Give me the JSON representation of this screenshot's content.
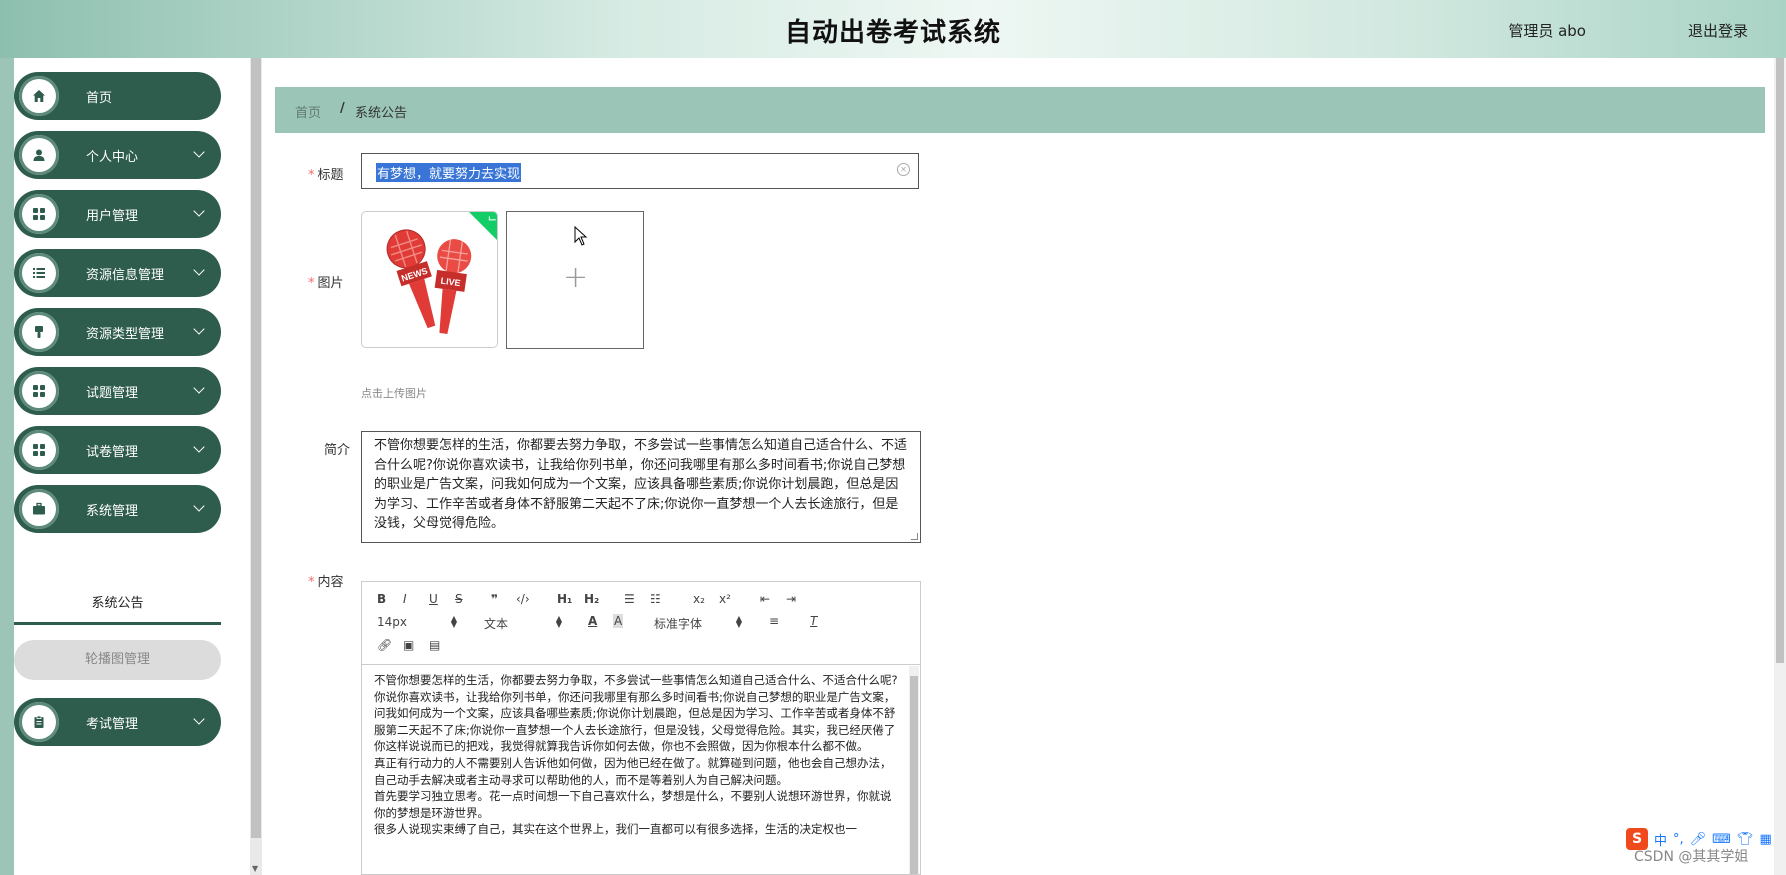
{
  "header": {
    "title": "自动出卷考试系统",
    "user": "管理员 abo",
    "logout": "退出登录"
  },
  "sidebar": {
    "items": [
      {
        "label": "首页",
        "icon": "home-icon",
        "has_children": false
      },
      {
        "label": "个人中心",
        "icon": "person-icon",
        "has_children": true
      },
      {
        "label": "用户管理",
        "icon": "grid-icon",
        "has_children": true
      },
      {
        "label": "资源信息管理",
        "icon": "list-icon",
        "has_children": true
      },
      {
        "label": "资源类型管理",
        "icon": "brush-icon",
        "has_children": true
      },
      {
        "label": "试题管理",
        "icon": "grid-icon",
        "has_children": true
      },
      {
        "label": "试卷管理",
        "icon": "grid-icon",
        "has_children": true
      },
      {
        "label": "系统管理",
        "icon": "briefcase-icon",
        "has_children": true
      },
      {
        "label": "考试管理",
        "icon": "clipboard-icon",
        "has_children": true
      }
    ],
    "submenu": {
      "active": "系统公告",
      "other": "轮播图管理"
    }
  },
  "breadcrumb": {
    "home": "首页",
    "separator": "/",
    "current": "系统公告"
  },
  "form": {
    "title_label": "标题",
    "title_value": "有梦想，就要努力去实现",
    "image_label": "图片",
    "image_icon": "news-microphone-icon",
    "upload_tip": "点击上传图片",
    "intro_label": "简介",
    "intro_value": "不管你想要怎样的生活，你都要去努力争取，不多尝试一些事情怎么知道自己适合什么、不适合什么呢?你说你喜欢读书，让我给你列书单，你还问我哪里有那么多时间看书;你说自己梦想的职业是广告文案，问我如何成为一个文案，应该具备哪些素质;你说你计划晨跑，但总是因为学习、工作辛苦或者身体不舒服第二天起不了床;你说你一直梦想一个人去长途旅行，但是没钱，父母觉得危险。",
    "content_label": "内容"
  },
  "editor": {
    "font_size": "14px",
    "block_type": "文本",
    "font_family": "标准字体",
    "paragraphs": [
      "不管你想要怎样的生活，你都要去努力争取，不多尝试一些事情怎么知道自己适合什么、不适合什么呢?",
      "你说你喜欢读书，让我给你列书单，你还问我哪里有那么多时间看书;你说自己梦想的职业是广告文案，问我如何成为一个文案，应该具备哪些素质;你说你计划晨跑，但总是因为学习、工作辛苦或者身体不舒服第二天起不了床;你说你一直梦想一个人去长途旅行，但是没钱，父母觉得危险。其实，我已经厌倦了你这样说说而已的把戏，我觉得就算我告诉你如何去做，你也不会照做，因为你根本什么都不做。",
      "真正有行动力的人不需要别人告诉他如何做，因为他已经在做了。就算碰到问题，他也会自己想办法，自己动手去解决或者主动寻求可以帮助他的人，而不是等着别人为自己解决问题。",
      "首先要学习独立思考。花一点时间想一下自己喜欢什么，梦想是什么，不要别人说想环游世界，你就说你的梦想是环游世界。",
      "很多人说现实束缚了自己，其实在这个世界上，我们一直都可以有很多选择，生活的决定权也一"
    ]
  },
  "taskbar": {
    "ime_logo": "S",
    "ime_lang": "中",
    "ime_punct": "°,",
    "watermark": "CSDN @其其学姐"
  }
}
